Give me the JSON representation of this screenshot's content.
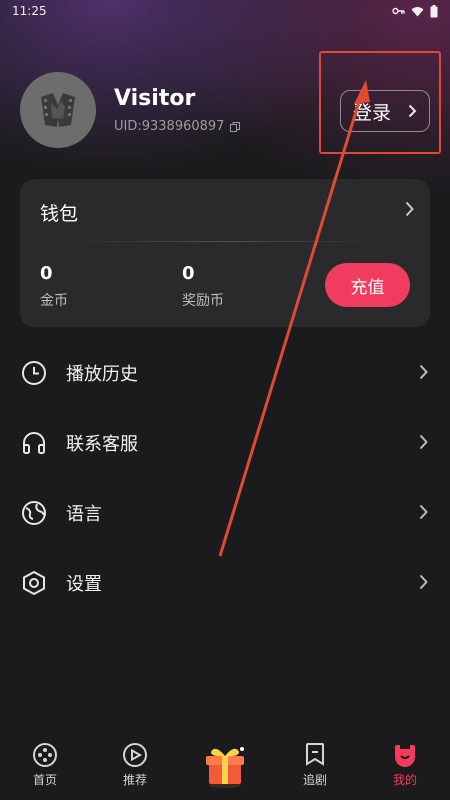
{
  "status_bar": {
    "time": "11:25"
  },
  "profile": {
    "username": "Visitor",
    "uid": "UID:9338960897",
    "login_label": "登录"
  },
  "wallet": {
    "title": "钱包",
    "coins": {
      "value": "0",
      "label": "金币"
    },
    "rewards": {
      "value": "0",
      "label": "奖励币"
    },
    "recharge_label": "充值"
  },
  "menu": [
    {
      "label": "播放历史",
      "icon": "clock-icon"
    },
    {
      "label": "联系客服",
      "icon": "headphones-icon"
    },
    {
      "label": "语言",
      "icon": "globe-icon"
    },
    {
      "label": "设置",
      "icon": "settings-hexagon-icon"
    }
  ],
  "tabbar": [
    {
      "label": "首页",
      "icon": "home-dots-icon"
    },
    {
      "label": "推荐",
      "icon": "eye-play-icon"
    },
    {
      "label": "",
      "icon": "gift-box-icon"
    },
    {
      "label": "追剧",
      "icon": "bookmark-icon"
    },
    {
      "label": "我的",
      "icon": "profile-smile-icon",
      "active": true
    }
  ],
  "colors": {
    "accent": "#f23c5f",
    "annotation": "#e04a35",
    "background": "#1b1b1d",
    "card": "#2a2a2d"
  }
}
